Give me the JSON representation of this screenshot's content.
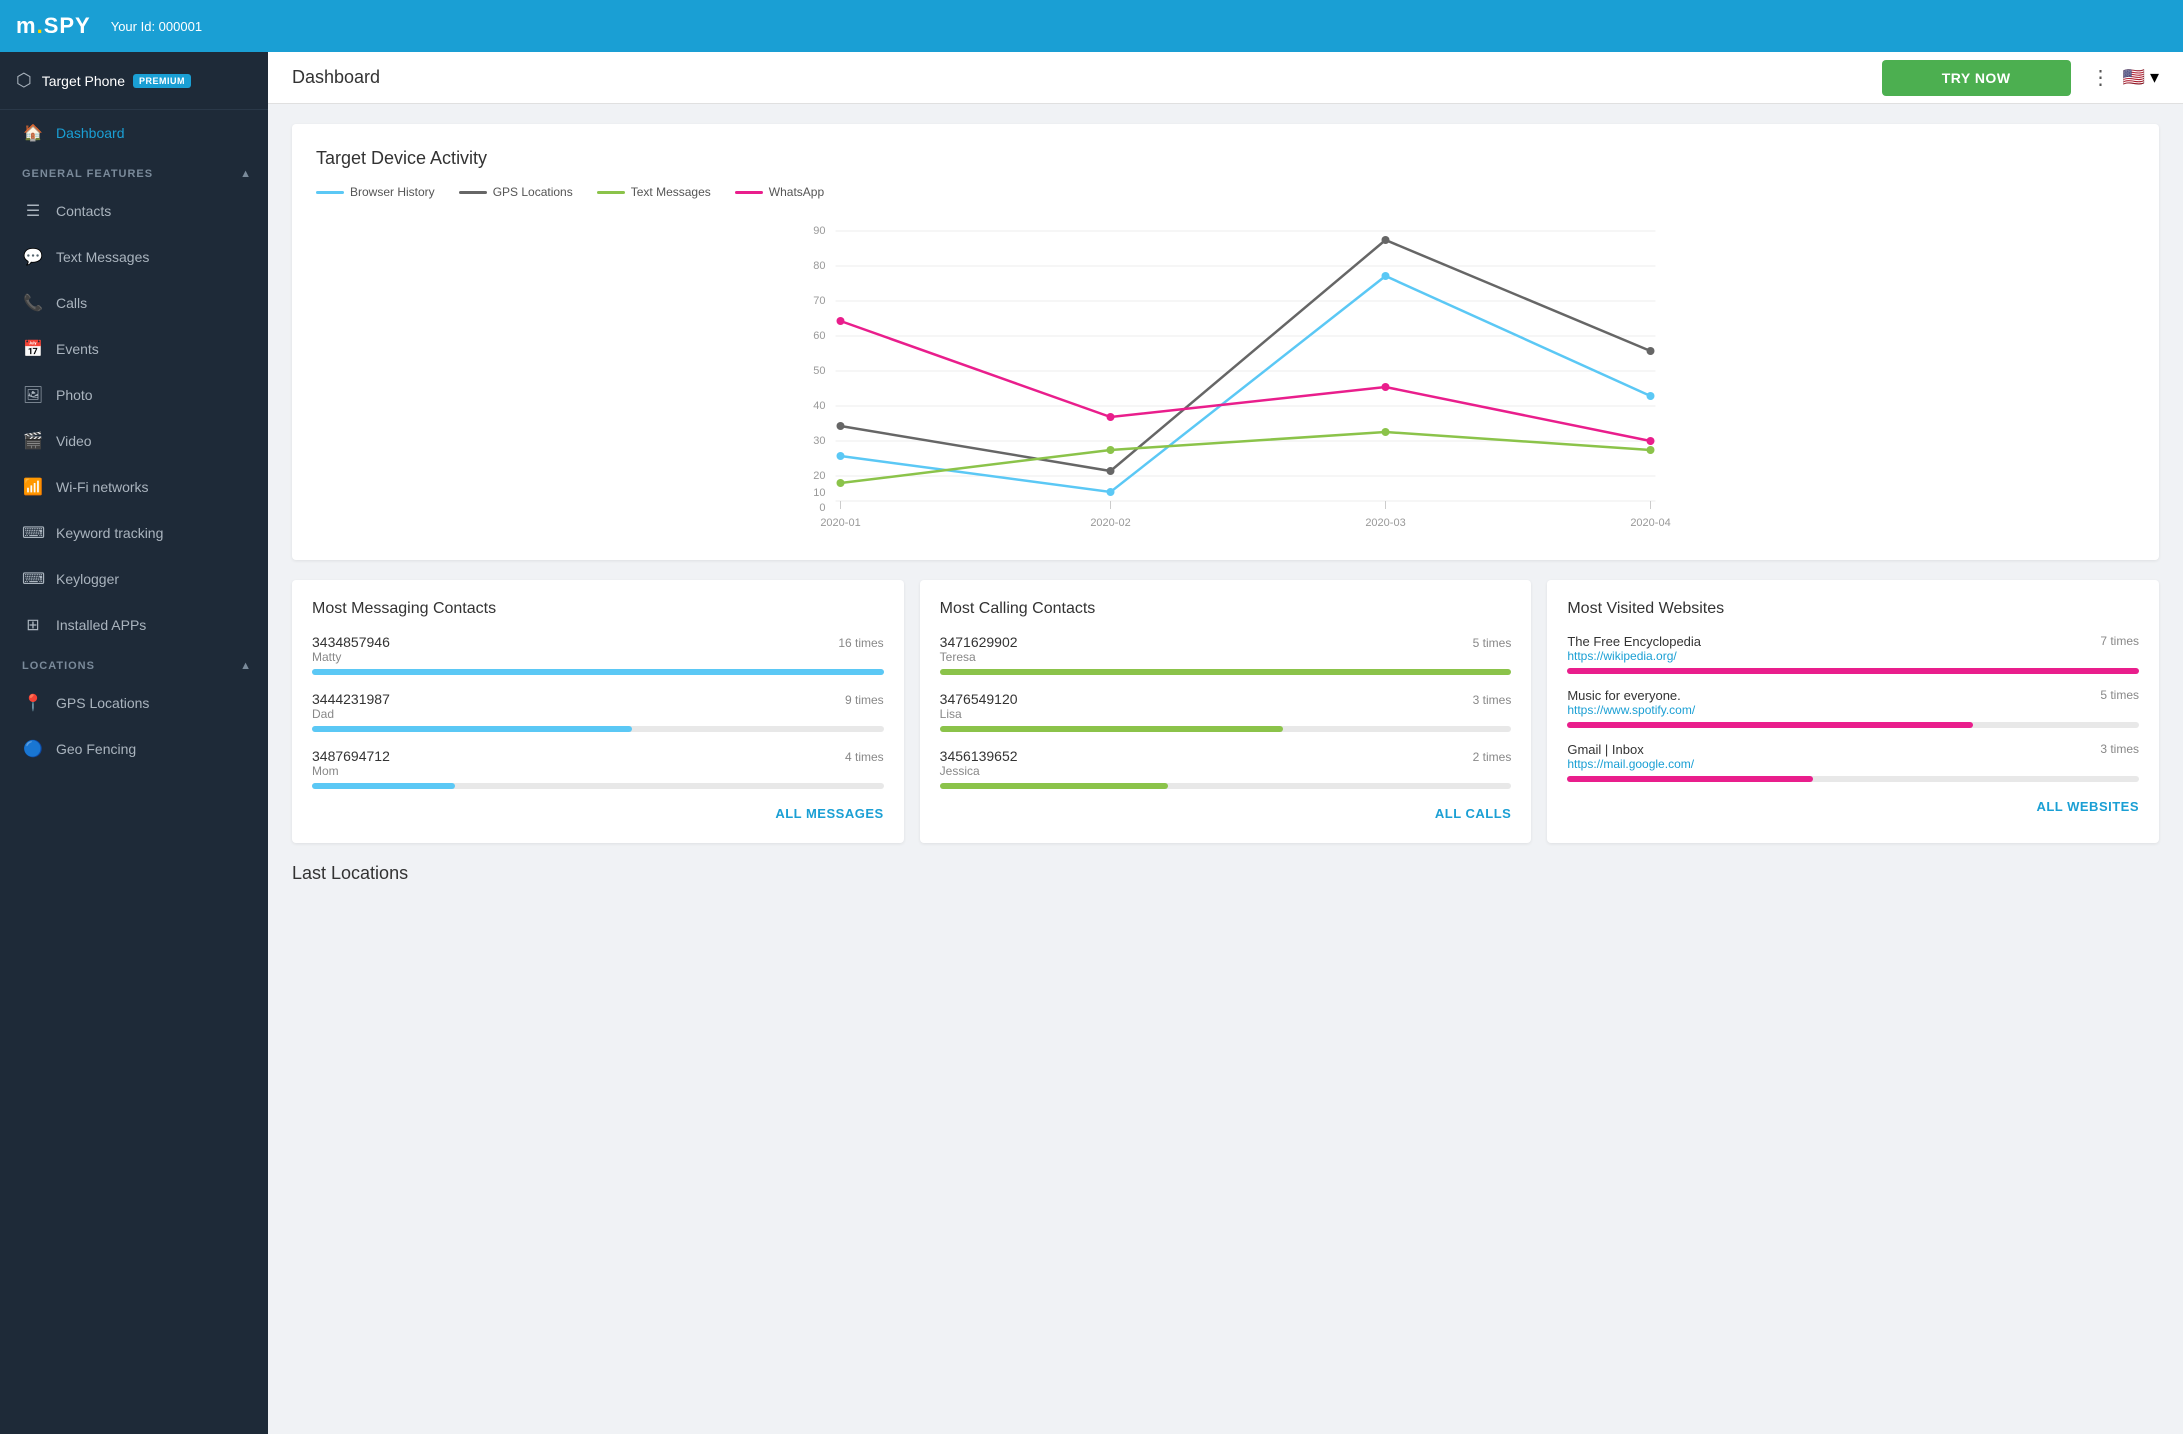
{
  "topbar": {
    "logo": "mSPY",
    "logo_dot": ".",
    "user_id_label": "Your Id: 000001"
  },
  "sidebar": {
    "target_label": "Target Phone",
    "premium_badge": "PREMIUM",
    "nav": {
      "dashboard_label": "Dashboard",
      "general_features_label": "GENERAL FEATURES",
      "contacts_label": "Contacts",
      "text_messages_label": "Text Messages",
      "calls_label": "Calls",
      "events_label": "Events",
      "photo_label": "Photo",
      "video_label": "Video",
      "wifi_label": "Wi-Fi networks",
      "keyword_tracking_label": "Keyword tracking",
      "keylogger_label": "Keylogger",
      "installed_apps_label": "Installed APPs",
      "locations_label": "LOCATIONS",
      "gps_locations_label": "GPS Locations",
      "geo_fencing_label": "Geo Fencing"
    }
  },
  "header": {
    "title": "Dashboard",
    "try_now": "TRY NOW"
  },
  "chart": {
    "title": "Target Device Activity",
    "legend": [
      {
        "label": "Browser History",
        "color": "#5bc8f5"
      },
      {
        "label": "GPS Locations",
        "color": "#666"
      },
      {
        "label": "Text Messages",
        "color": "#8bc34a"
      },
      {
        "label": "WhatsApp",
        "color": "#e91e8c"
      }
    ],
    "x_labels": [
      "2020-01",
      "2020-02",
      "2020-03",
      "2020-04"
    ],
    "y_labels": [
      "0",
      "10",
      "20",
      "30",
      "40",
      "50",
      "60",
      "70",
      "80",
      "90"
    ]
  },
  "messaging": {
    "title": "Most Messaging Contacts",
    "contacts": [
      {
        "number": "3434857946",
        "name": "Matty",
        "times": "16 times",
        "bar_pct": 100
      },
      {
        "number": "3444231987",
        "name": "Dad",
        "times": "9 times",
        "bar_pct": 56
      },
      {
        "number": "3487694712",
        "name": "Mom",
        "times": "4 times",
        "bar_pct": 25
      }
    ],
    "all_label": "ALL MESSAGES"
  },
  "calling": {
    "title": "Most Calling Contacts",
    "contacts": [
      {
        "number": "3471629902",
        "name": "Teresa",
        "times": "5 times",
        "bar_pct": 100
      },
      {
        "number": "3476549120",
        "name": "Lisa",
        "times": "3 times",
        "bar_pct": 60
      },
      {
        "number": "3456139652",
        "name": "Jessica",
        "times": "2 times",
        "bar_pct": 40
      }
    ],
    "all_label": "ALL CALLS"
  },
  "websites": {
    "title": "Most Visited Websites",
    "sites": [
      {
        "title": "The Free Encyclopedia",
        "url": "https://wikipedia.org/",
        "times": "7 times",
        "bar_pct": 100
      },
      {
        "title": "Music for everyone.",
        "url": "https://www.spotify.com/",
        "times": "5 times",
        "bar_pct": 71
      },
      {
        "title": "Gmail | Inbox",
        "url": "https://mail.google.com/",
        "times": "3 times",
        "bar_pct": 43
      }
    ],
    "all_label": "ALL WEBSITES"
  },
  "last_locations": {
    "title": "Last Locations"
  }
}
